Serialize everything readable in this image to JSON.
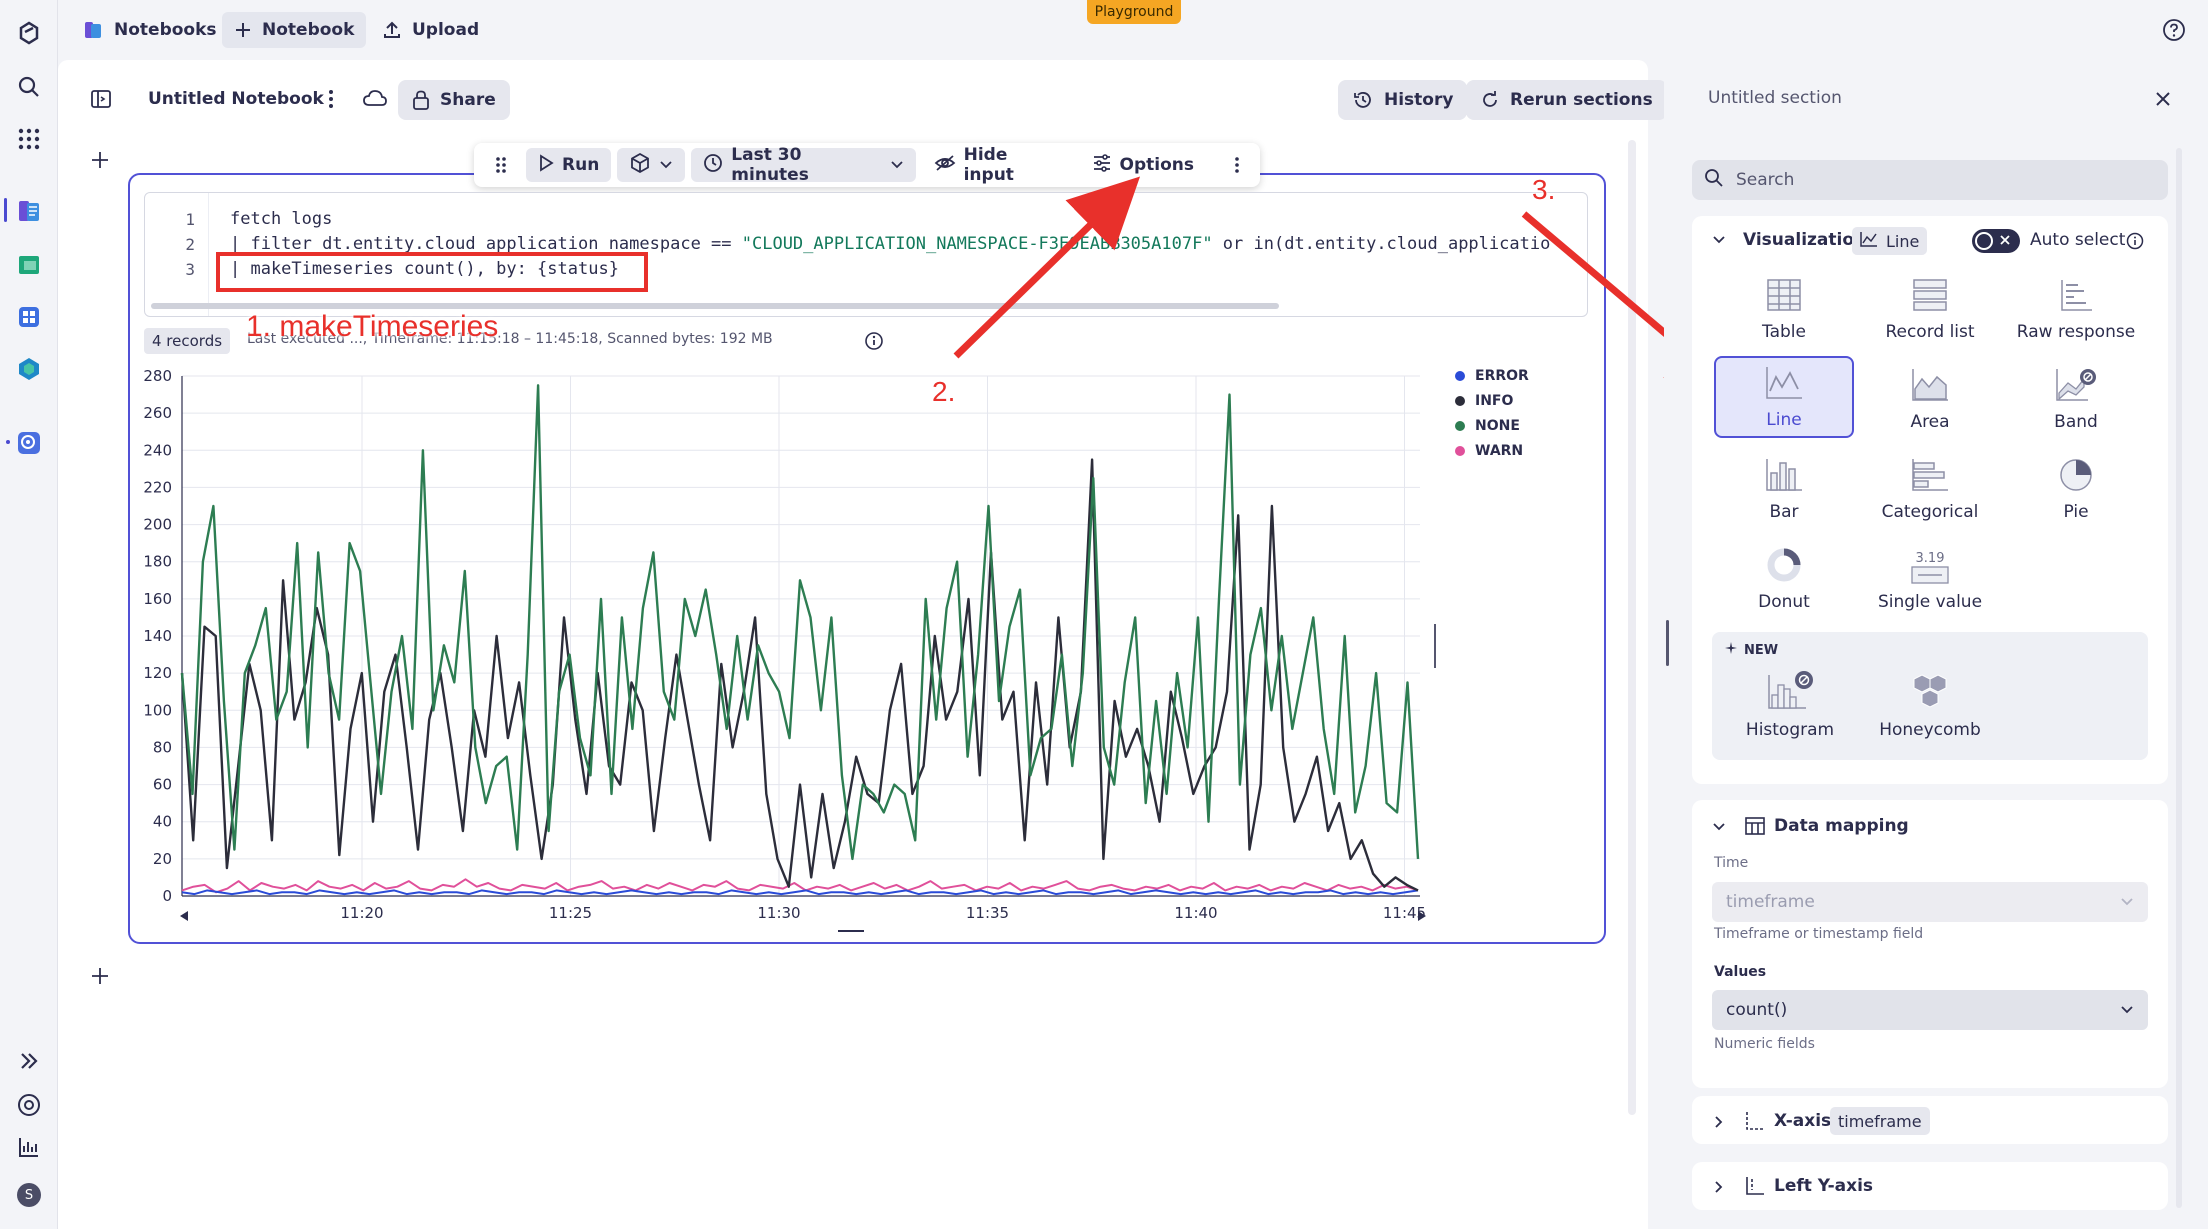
{
  "topbar": {
    "notebooks_label": "Notebooks",
    "notebook_label": "Notebook",
    "upload_label": "Upload",
    "badge": "Playground"
  },
  "header": {
    "title": "Untitled Notebook",
    "share_label": "Share",
    "history_label": "History",
    "rerun_label": "Rerun sections"
  },
  "toolbar": {
    "run_label": "Run",
    "timeframe_label": "Last 30 minutes",
    "hide_input_label": "Hide input",
    "options_label": "Options"
  },
  "editor": {
    "line_numbers": [
      "1",
      "2",
      "3"
    ],
    "line1": "fetch logs",
    "line2_prefix": "| filter dt.entity.cloud_application_namespace == ",
    "line2_string": "\"CLOUD_APPLICATION_NAMESPACE-F3E9EABB305A107F\"",
    "line2_suffix": " or in(dt.entity.cloud_applicatio",
    "line3": "| makeTimeseries count(), by: {status}"
  },
  "result": {
    "records": "4 records",
    "meta": "Last executed ..., Timeframe: 11:15:18 – 11:45:18, Scanned bytes: 192 MB"
  },
  "annotations": {
    "a1": "1. makeTimeseries",
    "a2": "2.",
    "a3": "3."
  },
  "chart_data": {
    "type": "line",
    "ylim": [
      0,
      280
    ],
    "yticks": [
      "0",
      "20",
      "40",
      "60",
      "80",
      "100",
      "120",
      "140",
      "160",
      "180",
      "200",
      "220",
      "240",
      "260",
      "280"
    ],
    "xticks": [
      "11:20",
      "11:25",
      "11:30",
      "11:35",
      "11:40",
      "11:45"
    ],
    "legend_position": "top-right",
    "series": [
      {
        "name": "ERROR",
        "color": "#2a4bd7",
        "values": [
          2,
          1,
          3,
          2,
          1,
          2,
          3,
          1,
          2,
          2,
          1,
          3,
          2,
          1,
          2,
          1,
          2,
          3,
          1,
          2,
          1,
          2,
          2,
          1,
          3,
          2,
          1,
          2,
          2,
          1,
          3,
          2,
          1,
          2,
          1,
          2,
          3,
          2,
          1,
          2,
          1,
          2,
          2,
          1,
          3,
          2,
          1,
          2,
          1,
          2,
          3,
          1,
          2,
          2,
          1,
          2,
          1,
          2,
          3,
          1,
          2,
          2,
          1,
          2,
          3,
          1,
          2,
          1,
          2,
          3,
          1,
          2,
          2,
          1,
          2,
          3,
          1,
          2,
          3,
          2,
          1,
          2,
          1,
          2,
          1,
          2,
          3,
          1,
          2,
          1,
          2,
          2,
          3,
          1,
          2,
          1,
          2,
          1,
          2,
          3
        ]
      },
      {
        "name": "INFO",
        "color": "#2c2d3a",
        "values": [
          120,
          30,
          145,
          140,
          15,
          70,
          125,
          100,
          30,
          170,
          95,
          115,
          155,
          130,
          22,
          90,
          120,
          40,
          110,
          130,
          80,
          25,
          95,
          120,
          80,
          35,
          100,
          75,
          140,
          85,
          115,
          65,
          20,
          60,
          150,
          95,
          55,
          120,
          70,
          60,
          115,
          100,
          35,
          85,
          130,
          95,
          60,
          30,
          125,
          80,
          110,
          150,
          55,
          20,
          5,
          60,
          10,
          55,
          15,
          40,
          75,
          55,
          50,
          100,
          125,
          55,
          70,
          140,
          95,
          110,
          160,
          65,
          185,
          95,
          110,
          30,
          115,
          60,
          150,
          80,
          110,
          235,
          20,
          105,
          75,
          90,
          70,
          40,
          110,
          85,
          55,
          70,
          80,
          110,
          205,
          25,
          60,
          210,
          80,
          40,
          55,
          75,
          35,
          50,
          20,
          30,
          12,
          5,
          10,
          6,
          3
        ]
      },
      {
        "name": "NONE",
        "color": "#2d7d52",
        "values": [
          120,
          55,
          180,
          210,
          105,
          25,
          120,
          135,
          155,
          95,
          110,
          190,
          80,
          185,
          120,
          95,
          190,
          175,
          115,
          55,
          110,
          140,
          90,
          240,
          100,
          135,
          115,
          175,
          80,
          50,
          70,
          75,
          25,
          130,
          275,
          35,
          110,
          130,
          85,
          65,
          160,
          55,
          150,
          90,
          155,
          185,
          110,
          95,
          160,
          140,
          165,
          130,
          90,
          140,
          95,
          135,
          120,
          110,
          85,
          170,
          150,
          100,
          150,
          65,
          20,
          60,
          55,
          45,
          60,
          55,
          30,
          160,
          95,
          155,
          180,
          75,
          130,
          210,
          105,
          145,
          165,
          65,
          85,
          90,
          130,
          70,
          120,
          225,
          80,
          60,
          115,
          150,
          50,
          105,
          55,
          120,
          80,
          150,
          40,
          160,
          270,
          60,
          130,
          155,
          100,
          140,
          90,
          120,
          150,
          90,
          55,
          140,
          45,
          70,
          120,
          50,
          45,
          115,
          20
        ]
      },
      {
        "name": "WARN",
        "color": "#e0509a",
        "values": [
          3,
          5,
          6,
          2,
          4,
          8,
          3,
          7,
          5,
          4,
          6,
          3,
          8,
          5,
          4,
          6,
          3,
          7,
          4,
          5,
          8,
          4,
          3,
          6,
          5,
          9,
          5,
          7,
          4,
          3,
          6,
          5,
          4,
          7,
          3,
          5,
          6,
          8,
          4,
          5,
          3,
          6,
          4,
          7,
          5,
          3,
          6,
          5,
          8,
          4,
          3,
          6,
          5,
          4,
          7,
          3,
          5,
          4,
          6,
          3,
          5,
          7,
          4,
          6,
          3,
          5,
          8,
          4,
          5,
          6,
          3,
          5,
          4,
          7,
          3,
          5,
          4,
          6,
          8,
          4,
          3,
          5,
          6,
          4,
          3,
          5,
          4,
          6,
          3,
          5,
          4,
          7,
          3,
          5,
          4,
          6,
          3,
          5,
          4,
          7,
          5,
          3,
          6,
          4,
          5,
          3,
          6,
          4,
          5,
          3
        ]
      }
    ]
  },
  "panel": {
    "title": "Untitled section",
    "search_placeholder": "Search",
    "visualization_label": "Visualization",
    "viz_current": "Line",
    "auto_select_label": "Auto select",
    "viz_options": [
      "Table",
      "Record list",
      "Raw response",
      "Line",
      "Area",
      "Band",
      "Bar",
      "Categorical",
      "Pie",
      "Donut",
      "Single value"
    ],
    "single_value_sample": "3.19",
    "new_label": "NEW",
    "new_options": [
      "Histogram",
      "Honeycomb"
    ],
    "data_mapping_label": "Data mapping",
    "time_label": "Time",
    "time_value": "timeframe",
    "time_hint": "Timeframe or timestamp field",
    "values_label": "Values",
    "values_value": "count()",
    "values_hint": "Numeric fields",
    "xaxis_label": "X-axis",
    "xaxis_value": "timeframe",
    "left_yaxis_label": "Left Y-axis"
  }
}
